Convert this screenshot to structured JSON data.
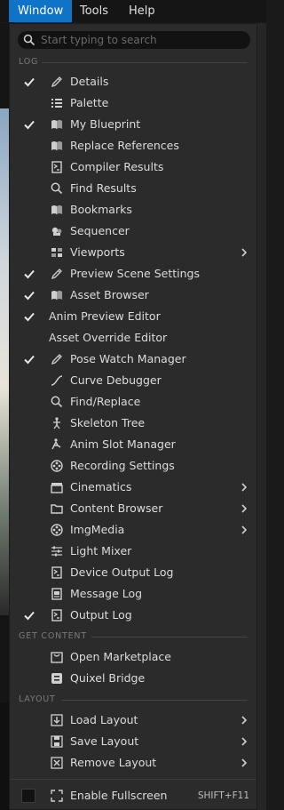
{
  "menubar": {
    "items": [
      {
        "label": "Window",
        "active": true
      },
      {
        "label": "Tools",
        "active": false
      },
      {
        "label": "Help",
        "active": false
      }
    ]
  },
  "search": {
    "placeholder": "Start typing to search",
    "value": ""
  },
  "sections": {
    "log": "LOG",
    "get_content": "GET CONTENT",
    "layout": "LAYOUT"
  },
  "log_items": [
    {
      "label": "Details",
      "checked": true,
      "icon": "pencil-icon",
      "submenu": false
    },
    {
      "label": "Palette",
      "checked": false,
      "icon": "list-icon",
      "submenu": false
    },
    {
      "label": "My Blueprint",
      "checked": true,
      "icon": "book-icon",
      "submenu": false
    },
    {
      "label": "Replace References",
      "checked": false,
      "icon": "book-icon",
      "submenu": false
    },
    {
      "label": "Compiler Results",
      "checked": false,
      "icon": "log-icon",
      "submenu": false
    },
    {
      "label": "Find Results",
      "checked": false,
      "icon": "search-icon",
      "submenu": false
    },
    {
      "label": "Bookmarks",
      "checked": false,
      "icon": "book-icon",
      "submenu": false
    },
    {
      "label": "Sequencer",
      "checked": false,
      "icon": "sequencer-icon",
      "submenu": false
    },
    {
      "label": "Viewports",
      "checked": false,
      "icon": "viewports-icon",
      "submenu": true
    },
    {
      "label": "Preview Scene Settings",
      "checked": true,
      "icon": "pencil-icon",
      "submenu": false
    },
    {
      "label": "Asset Browser",
      "checked": true,
      "icon": "book-icon",
      "submenu": false
    },
    {
      "label": "Anim Preview Editor",
      "checked": true,
      "icon": "",
      "submenu": false
    },
    {
      "label": "Asset Override Editor",
      "checked": false,
      "icon": "",
      "submenu": false
    },
    {
      "label": "Pose Watch Manager",
      "checked": true,
      "icon": "pencil-icon",
      "submenu": false
    },
    {
      "label": "Curve Debugger",
      "checked": false,
      "icon": "curve-icon",
      "submenu": false
    },
    {
      "label": "Find/Replace",
      "checked": false,
      "icon": "search-icon",
      "submenu": false
    },
    {
      "label": "Skeleton Tree",
      "checked": false,
      "icon": "skeleton-icon",
      "submenu": false
    },
    {
      "label": "Anim Slot Manager",
      "checked": false,
      "icon": "slot-icon",
      "submenu": false
    },
    {
      "label": "Recording Settings",
      "checked": false,
      "icon": "film-reel-icon",
      "submenu": false
    },
    {
      "label": "Cinematics",
      "checked": false,
      "icon": "clapper-icon",
      "submenu": true
    },
    {
      "label": "Content Browser",
      "checked": false,
      "icon": "folder-icon",
      "submenu": true
    },
    {
      "label": "ImgMedia",
      "checked": false,
      "icon": "film-reel-icon",
      "submenu": true
    },
    {
      "label": "Light Mixer",
      "checked": false,
      "icon": "light-icon",
      "submenu": false
    },
    {
      "label": "Device Output Log",
      "checked": false,
      "icon": "log-icon",
      "submenu": false
    },
    {
      "label": "Message Log",
      "checked": false,
      "icon": "message-log-icon",
      "submenu": false
    },
    {
      "label": "Output Log",
      "checked": true,
      "icon": "log-icon",
      "submenu": false
    }
  ],
  "content_items": [
    {
      "label": "Open Marketplace",
      "icon": "marketplace-icon"
    },
    {
      "label": "Quixel Bridge",
      "icon": "bridge-icon"
    }
  ],
  "layout_items": [
    {
      "label": "Load Layout",
      "icon": "load-layout-icon",
      "submenu": true
    },
    {
      "label": "Save Layout",
      "icon": "save-layout-icon",
      "submenu": true
    },
    {
      "label": "Remove Layout",
      "icon": "remove-layout-icon",
      "submenu": true
    }
  ],
  "fullscreen": {
    "label": "Enable Fullscreen",
    "shortcut": "SHIFT+F11",
    "checked": false
  },
  "colors": {
    "accent": "#0f73c7",
    "menu_bg": "#2b2b2b",
    "text": "#dcdcdc"
  }
}
